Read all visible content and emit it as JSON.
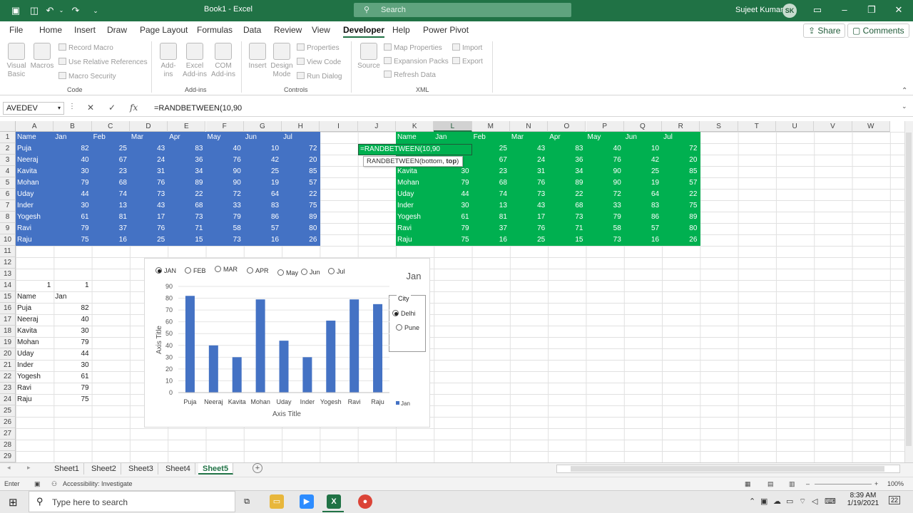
{
  "titlebar": {
    "filename": "Book1",
    "app": "Excel",
    "search_placeholder": "Search",
    "user_name": "Sujeet Kumar",
    "user_initials": "SK"
  },
  "menu": {
    "items": [
      "File",
      "Home",
      "Insert",
      "Draw",
      "Page Layout",
      "Formulas",
      "Data",
      "Review",
      "View",
      "Developer",
      "Help",
      "Power Pivot"
    ],
    "active": "Developer",
    "share_label": "Share",
    "comments_label": "Comments"
  },
  "ribbon": {
    "code": {
      "label": "Code",
      "visual_basic": "Visual Basic",
      "macros": "Macros",
      "record_macro": "Record Macro",
      "relative_refs": "Use Relative References",
      "macro_security": "Macro Security"
    },
    "addins": {
      "label": "Add-ins",
      "addins": "Add-ins",
      "excel_addins": "Excel Add-ins",
      "com_addins": "COM Add-ins"
    },
    "controls": {
      "label": "Controls",
      "insert": "Insert",
      "design_mode": "Design Mode",
      "properties": "Properties",
      "view_code": "View Code",
      "run_dialog": "Run Dialog"
    },
    "xml": {
      "label": "XML",
      "source": "Source",
      "map_properties": "Map Properties",
      "expansion_packs": "Expansion Packs",
      "refresh_data": "Refresh Data",
      "import": "Import",
      "export": "Export"
    }
  },
  "formula_bar": {
    "name_box": "AVEDEV",
    "formula": "=RANDBETWEEN(10,90"
  },
  "columns": [
    "A",
    "B",
    "C",
    "D",
    "E",
    "F",
    "G",
    "H",
    "I",
    "J",
    "K",
    "L",
    "M",
    "N",
    "O",
    "P",
    "Q",
    "R",
    "S",
    "T",
    "U",
    "V",
    "W"
  ],
  "rows": [
    "1",
    "2",
    "3",
    "4",
    "5",
    "6",
    "7",
    "8",
    "9",
    "10",
    "11",
    "12",
    "13",
    "14",
    "15",
    "16",
    "17",
    "18",
    "19",
    "20",
    "21",
    "22",
    "23",
    "24",
    "25",
    "26",
    "27",
    "28",
    "29"
  ],
  "table_headers": [
    "Name",
    "Jan",
    "Feb",
    "Mar",
    "Apr",
    "May",
    "Jun",
    "Jul"
  ],
  "table_rows": [
    [
      "Puja",
      "82",
      "25",
      "43",
      "83",
      "40",
      "10",
      "72"
    ],
    [
      "Neeraj",
      "40",
      "67",
      "24",
      "36",
      "76",
      "42",
      "20"
    ],
    [
      "Kavita",
      "30",
      "23",
      "31",
      "34",
      "90",
      "25",
      "85"
    ],
    [
      "Mohan",
      "79",
      "68",
      "76",
      "89",
      "90",
      "19",
      "57"
    ],
    [
      "Uday",
      "44",
      "74",
      "73",
      "22",
      "72",
      "64",
      "22"
    ],
    [
      "Inder",
      "30",
      "13",
      "43",
      "68",
      "33",
      "83",
      "75"
    ],
    [
      "Yogesh",
      "61",
      "81",
      "17",
      "73",
      "79",
      "86",
      "89"
    ],
    [
      "Ravi",
      "79",
      "37",
      "76",
      "71",
      "58",
      "57",
      "80"
    ],
    [
      "Raju",
      "75",
      "16",
      "25",
      "15",
      "73",
      "16",
      "26"
    ]
  ],
  "green_l2_partial": "0",
  "edit_cell_text": "=RANDBETWEEN(10,90",
  "tooltip": {
    "fn": "RANDBETWEEN(bottom, ",
    "arg": "top",
    "close": ")"
  },
  "lower_table": {
    "a14": "1",
    "b14": "1",
    "header_name": "Name",
    "header_month": "Jan"
  },
  "chart_controls": {
    "months": [
      "JAN",
      "FEB",
      "MAR",
      "APR",
      "May",
      "Jun",
      "Jul"
    ],
    "selected_month": "JAN",
    "city_label": "City",
    "cities": [
      "Delhi",
      "Pune"
    ],
    "selected_city": "Delhi"
  },
  "chart_data": {
    "type": "bar",
    "title": "Jan",
    "categories": [
      "Puja",
      "Neeraj",
      "Kavita",
      "Mohan",
      "Uday",
      "Inder",
      "Yogesh",
      "Ravi",
      "Raju"
    ],
    "series": [
      {
        "name": "Jan",
        "values": [
          82,
          40,
          30,
          79,
          44,
          30,
          61,
          79,
          75
        ]
      }
    ],
    "xlabel": "Axis Title",
    "ylabel": "Axis Title",
    "ylim": [
      0,
      90
    ],
    "yticks": [
      "0",
      "10",
      "20",
      "30",
      "40",
      "50",
      "60",
      "70",
      "80",
      "90"
    ],
    "bar_color": "#4472c4",
    "legend": "bottom-right"
  },
  "sheets": [
    "Sheet1",
    "Sheet2",
    "Sheet3",
    "Sheet4",
    "Sheet5"
  ],
  "active_sheet": "Sheet5",
  "status": {
    "mode": "Enter",
    "accessibility": "Accessibility: Investigate",
    "zoom": "100%"
  },
  "taskbar": {
    "search_placeholder": "Type here to search",
    "time": "8:39 AM",
    "date": "1/19/2021",
    "notifications": "22"
  },
  "colors": {
    "excel_green": "#207245",
    "table_blue": "#4472c4",
    "table_green": "#00b050"
  }
}
